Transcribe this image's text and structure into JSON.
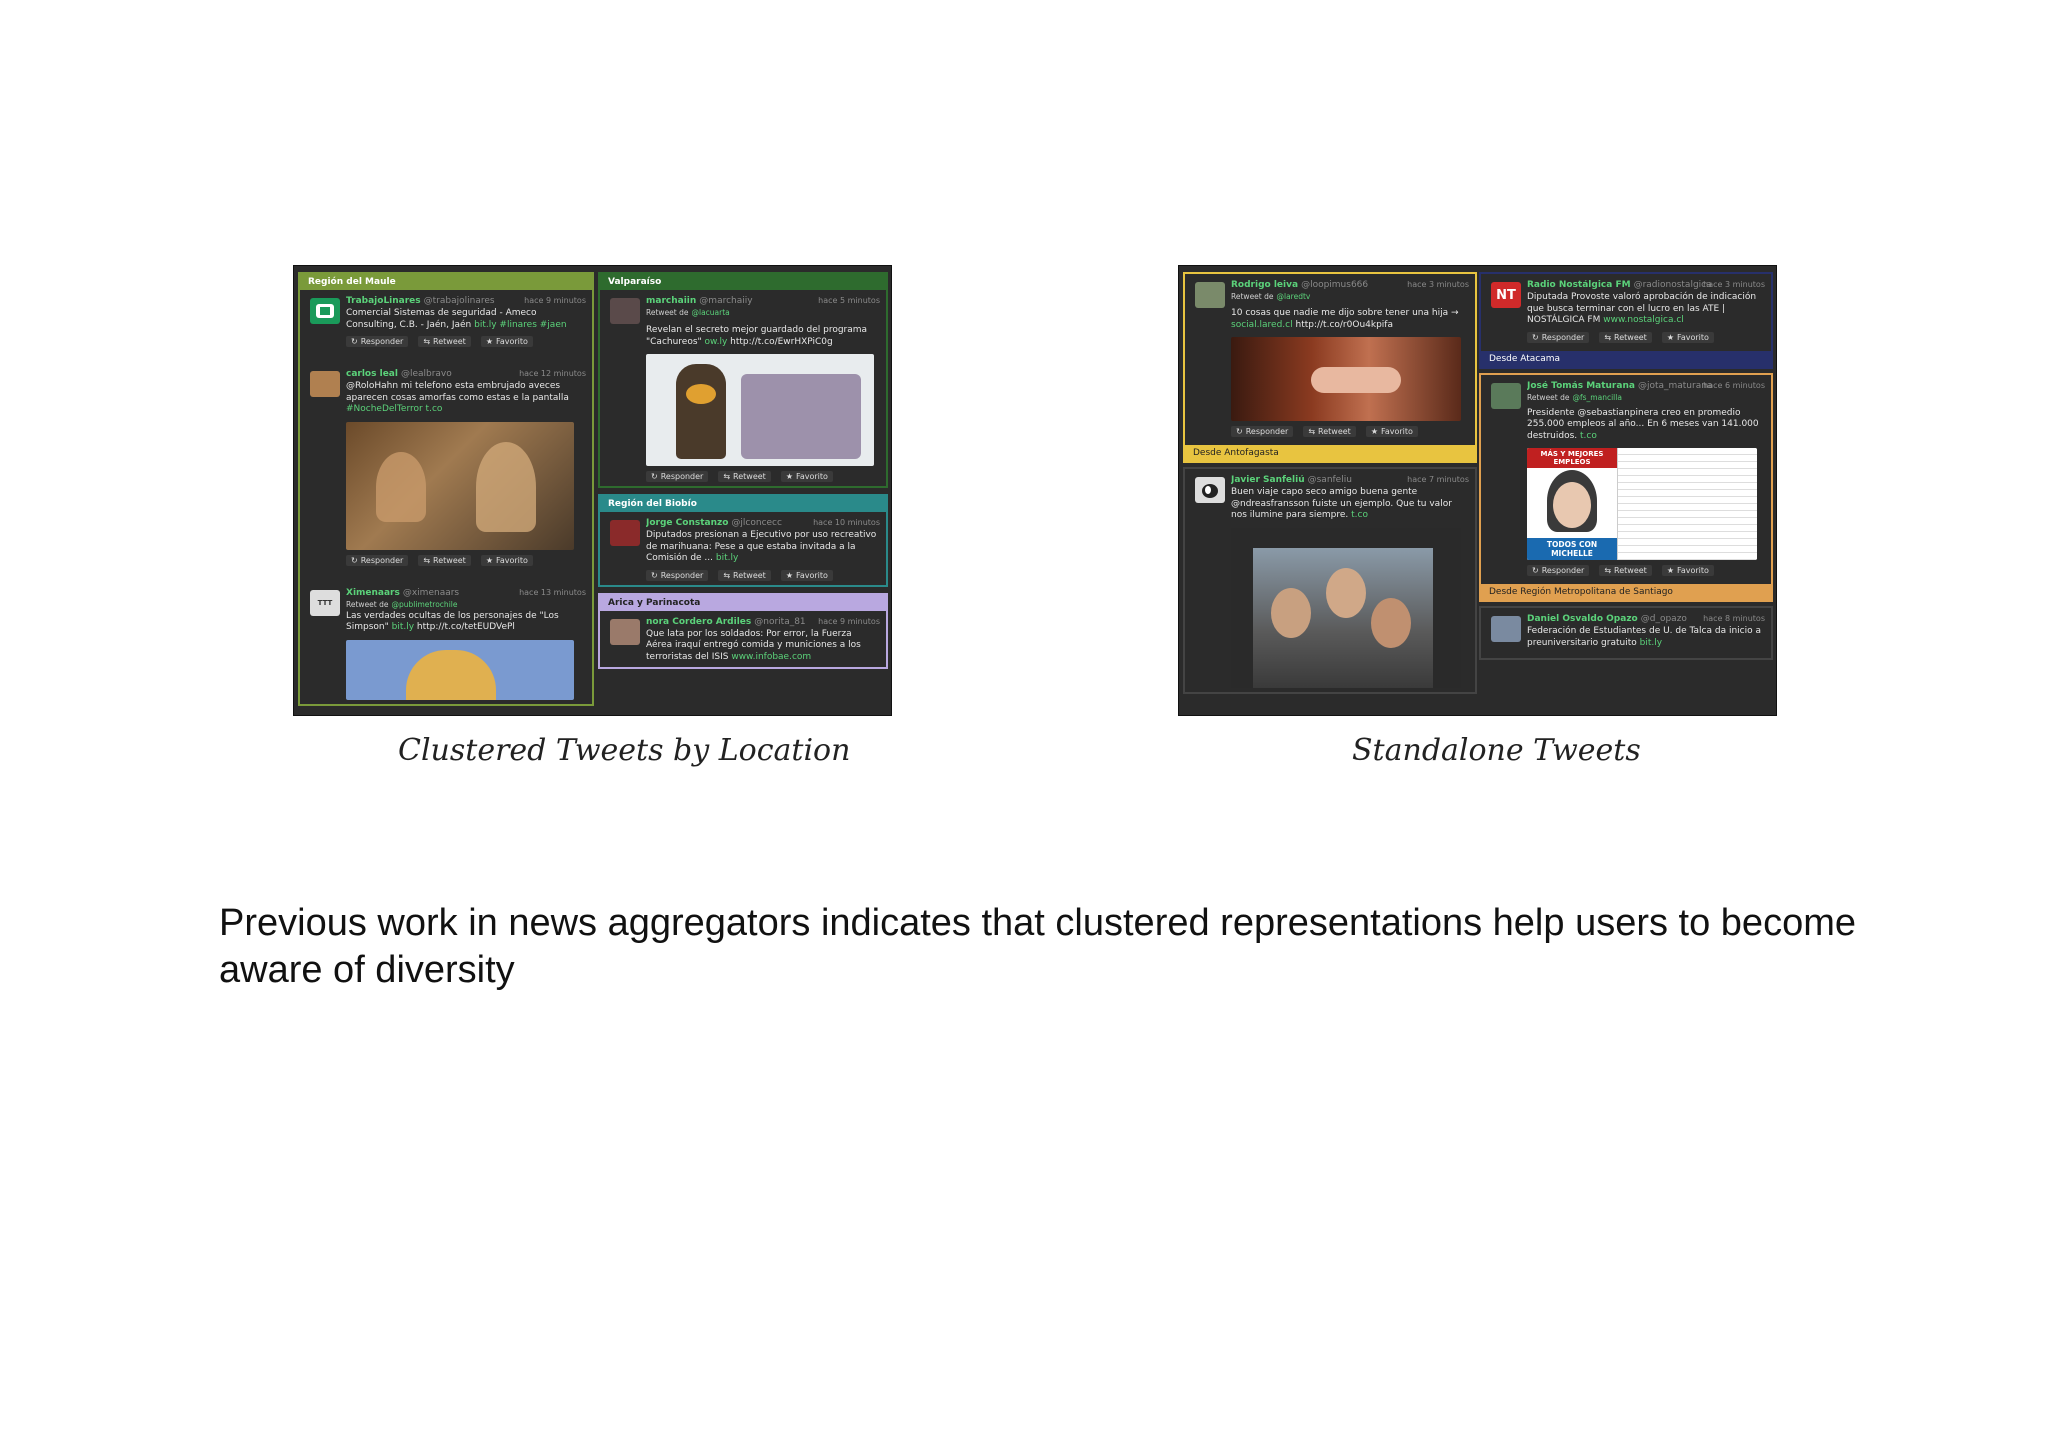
{
  "left_panel": {
    "clusters": [
      {
        "header": "Región del Maule",
        "tweets": [
          {
            "name": "TrabajoLinares",
            "handle": "@trabajolinares",
            "time": "hace 9 minutos",
            "text": "Comercial Sistemas de seguridad - Ameco Consulting, C.B. - Jaén, Jaén",
            "link": "bit.ly #linares #jaen"
          },
          {
            "name": "carlos leal",
            "handle": "@lealbravo",
            "time": "hace 12 minutos",
            "text": "@RoloHahn mi telefono esta embrujado aveces aparecen cosas amorfas como estas e la pantalla",
            "link": "#NocheDelTerror t.co"
          },
          {
            "name": "Ximenaars",
            "handle": "@ximenaars",
            "time": "hace 13 minutos",
            "retweet": "Retweet de",
            "retweet_of": "@publimetrochile",
            "text": "Las verdades ocultas de los personajes de \"Los Simpson\"",
            "link": "bit.ly",
            "text2": "http://t.co/tetEUDVePl"
          }
        ]
      },
      {
        "header": "Valparaíso",
        "tweets": [
          {
            "name": "marchaiin",
            "handle": "@marchaiiy",
            "time": "hace 5 minutos",
            "retweet": "Retweet de",
            "retweet_of": "@lacuarta",
            "text": "Revelan el secreto mejor guardado del programa \"Cachureos\"",
            "link": "ow.ly",
            "text2": "http://t.co/EwrHXPiC0g"
          }
        ]
      },
      {
        "header": "Región del Biobío",
        "tweets": [
          {
            "name": "Jorge Constanzo",
            "handle": "@jlconcecc",
            "time": "hace 10 minutos",
            "text": "Diputados presionan a Ejecutivo por uso recreativo de marihuana: Pese a que estaba invitada a la Comisión de ...",
            "link": "bit.ly"
          }
        ]
      },
      {
        "header": "Arica y Parinacota",
        "tweets": [
          {
            "name": "nora Cordero Ardiles",
            "handle": "@norita_81",
            "time": "hace 9 minutos",
            "text": "Que lata por los soldados: Por error, la Fuerza Aérea iraquí entregó comida y municiones a los terroristas del ISIS",
            "link": "www.infobae.com"
          }
        ]
      }
    ],
    "actions": {
      "reply": "Responder",
      "retweet": "Retweet",
      "favorite": "Favorito"
    }
  },
  "right_panel": {
    "tweets_left": [
      {
        "name": "Rodrigo leiva",
        "handle": "@loopimus666",
        "time": "hace 3 minutos",
        "retweet": "Retweet de",
        "retweet_of": "@laredtv",
        "text": "10 cosas que nadie me dijo sobre tener una hija →",
        "link": "social.lared.cl",
        "text2": "http://t.co/r0Ou4kpifa",
        "footer": "Desde Antofagasta"
      },
      {
        "name": "Javier Sanfeliú",
        "handle": "@sanfeliu",
        "time": "hace 7 minutos",
        "text": "Buen viaje capo seco amigo buena gente @ndreasfransson fuiste un ejemplo. Que tu valor nos ilumine para siempre.",
        "link": "t.co"
      }
    ],
    "tweets_right": [
      {
        "name": "Radio Nostálgica FM",
        "handle": "@radionostalgica",
        "time": "hace 3 minutos",
        "avatar_text": "NT",
        "text": "Diputada Provoste valoró aprobación de indicación que busca terminar con el lucro en las ATE | NOSTÁLGICA FM",
        "link": "www.nostalgica.cl",
        "footer": "Desde Atacama"
      },
      {
        "name": "José Tomás Maturana",
        "handle": "@jota_maturana",
        "time": "hace 6 minutos",
        "retweet": "Retweet de",
        "retweet_of": "@fs_mancilla",
        "text": "Presidente @sebastianpinera creo en promedio 255.000 empleos al año... En 6 meses van 141.000 destruidos.",
        "link": "t.co",
        "poster_top": "MÁS Y MEJORES EMPLEOS",
        "poster_bottom": "TODOS CON MICHELLE",
        "footer": "Desde Región Metropolitana de Santiago"
      },
      {
        "name": "Daniel Osvaldo Opazo",
        "handle": "@d_opazo",
        "time": "hace 8 minutos",
        "text": "Federación de Estudiantes de U. de Talca da inicio a preuniversitario gratuito",
        "link": "bit.ly"
      }
    ],
    "actions": {
      "reply": "Responder",
      "retweet": "Retweet",
      "favorite": "Favorito"
    }
  },
  "captions": {
    "left": "Clustered Tweets by Location",
    "right": "Standalone Tweets"
  },
  "body_text": "Previous work in news aggregators indicates that clustered representations help users to become aware of diversity",
  "colors": {
    "maule": "#7a9a3a",
    "valparaiso": "#2e6b2e",
    "biobio": "#2a8a8a",
    "arica": "#b9a8e0",
    "antofagasta": "#e8c440",
    "atacama": "#27306b",
    "metropolitana": "#e0a050",
    "link": "#5bd27a"
  }
}
